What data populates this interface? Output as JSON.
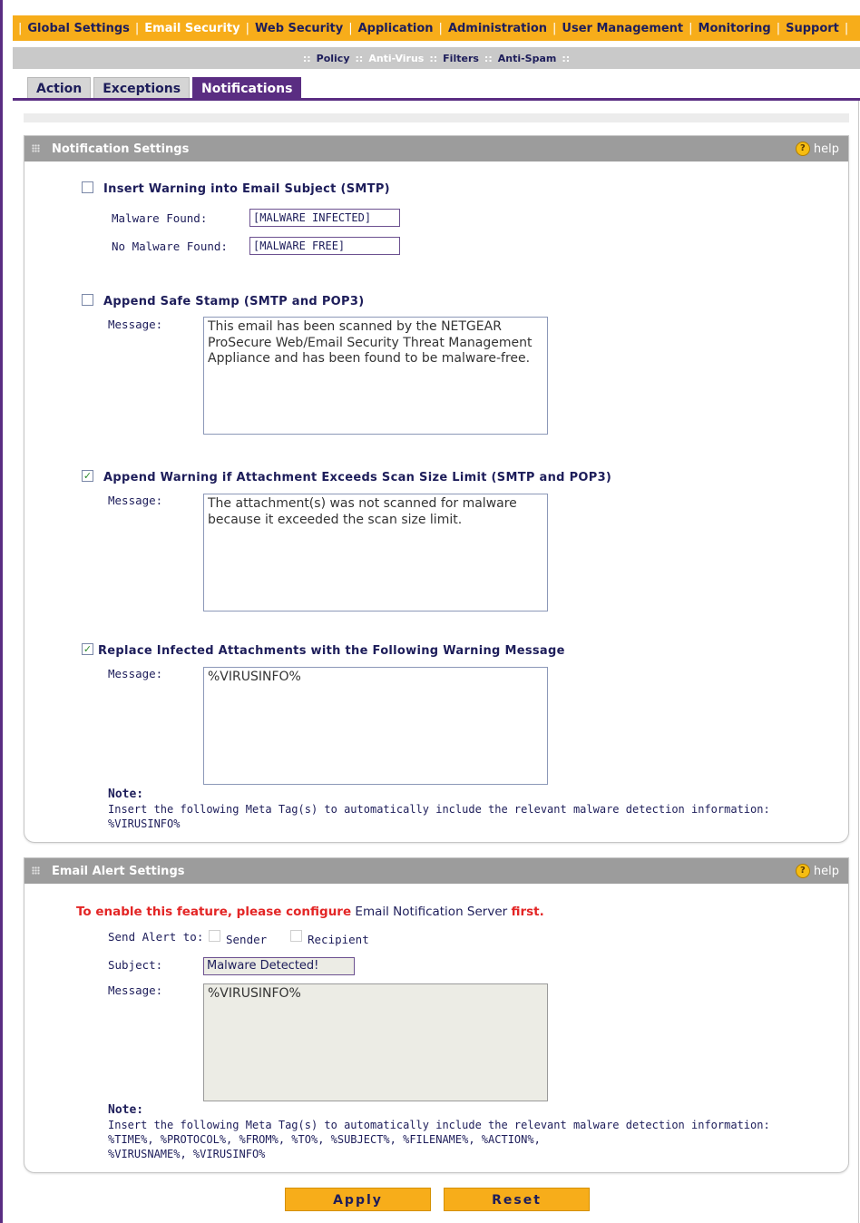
{
  "nav": {
    "items": [
      "Global Settings",
      "Email Security",
      "Web Security",
      "Application",
      "Administration",
      "User Management",
      "Monitoring",
      "Support"
    ],
    "active_index": 1
  },
  "subnav": {
    "items": [
      "Policy",
      "Anti-Virus",
      "Filters",
      "Anti-Spam"
    ],
    "active_index": 1
  },
  "tabs": {
    "items": [
      "Action",
      "Exceptions",
      "Notifications"
    ],
    "active_index": 2
  },
  "notification_settings": {
    "title": "Notification Settings",
    "help": "help",
    "insert_warning": {
      "label": "Insert Warning into Email Subject (SMTP)",
      "checked": false,
      "malware_found_label": "Malware Found:",
      "malware_found_value": "[MALWARE INFECTED]",
      "no_malware_label": "No Malware Found:",
      "no_malware_value": "[MALWARE FREE]"
    },
    "safe_stamp": {
      "label": "Append Safe Stamp (SMTP and POP3)",
      "checked": false,
      "message_label": "Message:",
      "message": "This email has been scanned by the NETGEAR ProSecure Web/Email Security Threat Management Appliance and has been found to be malware-free."
    },
    "size_limit_warning": {
      "label": "Append Warning if Attachment Exceeds Scan Size Limit (SMTP and POP3)",
      "checked": true,
      "message_label": "Message:",
      "message": "The attachment(s) was not scanned for malware because it exceeded the scan size limit."
    },
    "replace_infected": {
      "label": "Replace Infected Attachments with the Following Warning Message",
      "checked": true,
      "message_label": "Message:",
      "message": "%VIRUSINFO%"
    },
    "note_title": "Note:",
    "note_text": "Insert the following Meta Tag(s) to automatically include the relevant malware detection information:",
    "note_tags": "%VIRUSINFO%"
  },
  "email_alert_settings": {
    "title": "Email Alert Settings",
    "help": "help",
    "warning_pre": "To enable this feature, please configure",
    "warning_link": " Email Notification Server ",
    "warning_post": "first.",
    "send_alert_label": "Send Alert to:",
    "sender_label": "Sender",
    "recipient_label": "Recipient",
    "subject_label": "Subject:",
    "subject_value": "Malware Detected!",
    "message_label": "Message:",
    "message": "%VIRUSINFO%",
    "note_title": "Note:",
    "note_text": "Insert the following Meta Tag(s) to automatically include the relevant malware detection information:",
    "note_tags_line1": "%TIME%, %PROTOCOL%, %FROM%, %TO%, %SUBJECT%, %FILENAME%, %ACTION%,",
    "note_tags_line2": "%VIRUSNAME%, %VIRUSINFO%"
  },
  "buttons": {
    "apply": "Apply",
    "reset": "Reset"
  },
  "colors": {
    "nav_orange": "#f7ad1a",
    "accent_purple": "#5a2d82",
    "header_gray": "#9c9c9c",
    "alert_red": "#e32525"
  }
}
